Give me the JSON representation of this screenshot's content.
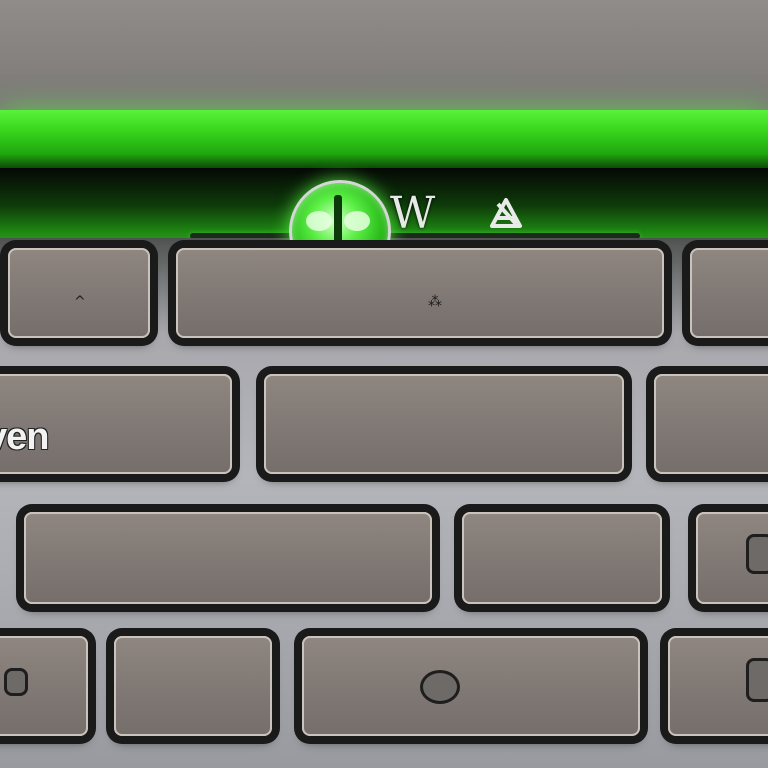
{
  "photo": {
    "subject": "laptop-keyboard-with-green-backlit-power-button",
    "accent_color": "#39d61d",
    "key_color": "#807874",
    "deck_color": "#a8a8ad"
  },
  "status_indicators": {
    "w_glyph": "W",
    "mute_glyph": "⊠"
  },
  "keys": {
    "row1_left_glyph": "^",
    "row1_center_glyph": "⁂",
    "row2_brand_label": "ven"
  },
  "icons": {
    "power": "power-icon",
    "mute": "mute-icon",
    "lock": "lock-icon",
    "camera": "camera-icon"
  }
}
